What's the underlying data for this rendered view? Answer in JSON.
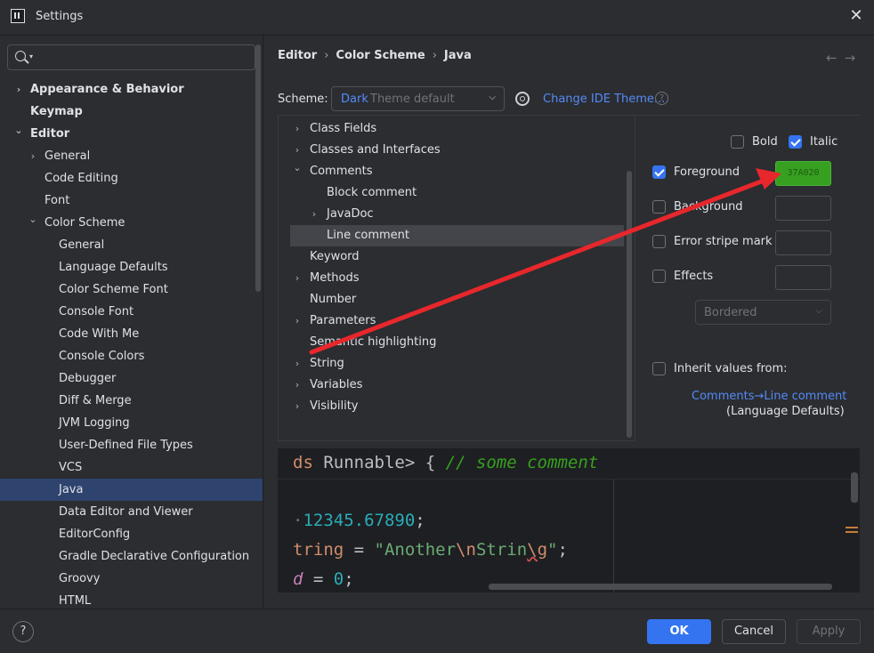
{
  "window": {
    "title": "Settings"
  },
  "search": {
    "placeholder": "",
    "value": ""
  },
  "sidebar": {
    "items": [
      {
        "label": "Appearance & Behavior",
        "level": 0,
        "chevron": ">",
        "bold": true
      },
      {
        "label": "Keymap",
        "level": 0,
        "chevron": "",
        "bold": true
      },
      {
        "label": "Editor",
        "level": 0,
        "chevron": "v",
        "bold": true
      },
      {
        "label": "General",
        "level": 1,
        "chevron": ">"
      },
      {
        "label": "Code Editing",
        "level": 1,
        "chevron": ""
      },
      {
        "label": "Font",
        "level": 1,
        "chevron": ""
      },
      {
        "label": "Color Scheme",
        "level": 1,
        "chevron": "v"
      },
      {
        "label": "General",
        "level": 2,
        "chevron": ""
      },
      {
        "label": "Language Defaults",
        "level": 2,
        "chevron": ""
      },
      {
        "label": "Color Scheme Font",
        "level": 2,
        "chevron": ""
      },
      {
        "label": "Console Font",
        "level": 2,
        "chevron": ""
      },
      {
        "label": "Code With Me",
        "level": 2,
        "chevron": ""
      },
      {
        "label": "Console Colors",
        "level": 2,
        "chevron": ""
      },
      {
        "label": "Debugger",
        "level": 2,
        "chevron": ""
      },
      {
        "label": "Diff & Merge",
        "level": 2,
        "chevron": ""
      },
      {
        "label": "JVM Logging",
        "level": 2,
        "chevron": ""
      },
      {
        "label": "User-Defined File Types",
        "level": 2,
        "chevron": ""
      },
      {
        "label": "VCS",
        "level": 2,
        "chevron": ""
      },
      {
        "label": "Java",
        "level": 2,
        "chevron": "",
        "selected": true
      },
      {
        "label": "Data Editor and Viewer",
        "level": 2,
        "chevron": ""
      },
      {
        "label": "EditorConfig",
        "level": 2,
        "chevron": ""
      },
      {
        "label": "Gradle Declarative Configuration",
        "level": 2,
        "chevron": ""
      },
      {
        "label": "Groovy",
        "level": 2,
        "chevron": ""
      },
      {
        "label": "HTML",
        "level": 2,
        "chevron": ""
      }
    ]
  },
  "breadcrumb": {
    "items": [
      "Editor",
      "Color Scheme",
      "Java"
    ]
  },
  "scheme": {
    "label": "Scheme:",
    "value_name": "Dark",
    "value_suffix": "Theme default",
    "change_theme": "Change IDE Theme..."
  },
  "attributes": {
    "items": [
      {
        "label": "Class Fields",
        "level": 0,
        "chevron": ">"
      },
      {
        "label": "Classes and Interfaces",
        "level": 0,
        "chevron": ">"
      },
      {
        "label": "Comments",
        "level": 0,
        "chevron": "v"
      },
      {
        "label": "Block comment",
        "level": 1,
        "chevron": ""
      },
      {
        "label": "JavaDoc",
        "level": 1,
        "chevron": ">"
      },
      {
        "label": "Line comment",
        "level": 1,
        "chevron": "",
        "selected": true
      },
      {
        "label": "Keyword",
        "level": 0,
        "chevron": ""
      },
      {
        "label": "Methods",
        "level": 0,
        "chevron": ">"
      },
      {
        "label": "Number",
        "level": 0,
        "chevron": ""
      },
      {
        "label": "Parameters",
        "level": 0,
        "chevron": ">"
      },
      {
        "label": "Semantic highlighting",
        "level": 0,
        "chevron": ""
      },
      {
        "label": "String",
        "level": 0,
        "chevron": ">"
      },
      {
        "label": "Variables",
        "level": 0,
        "chevron": ">"
      },
      {
        "label": "Visibility",
        "level": 0,
        "chevron": ">"
      }
    ]
  },
  "options": {
    "bold": {
      "label": "Bold",
      "checked": false
    },
    "italic": {
      "label": "Italic",
      "checked": true
    },
    "foreground": {
      "label": "Foreground",
      "checked": true,
      "color_text": "37A020",
      "color": "#37a020"
    },
    "background": {
      "label": "Background",
      "checked": false
    },
    "error_stripe": {
      "label": "Error stripe mark",
      "checked": false
    },
    "effects": {
      "label": "Effects",
      "checked": false,
      "effect_type": "Bordered"
    },
    "inherit": {
      "label": "Inherit values from:",
      "checked": false,
      "link": "Comments→Line comment",
      "sub": "(Language Defaults)"
    }
  },
  "preview": {
    "line1": {
      "kw": "ds",
      "tx": " Runnable> { ",
      "cm": "// some comment"
    },
    "line2": {
      "tx": "·",
      "num": "12345.67890",
      "end": ";"
    },
    "line3": {
      "kw": "tring",
      "tx": " = ",
      "q1": "\"Another",
      "esc1": "\\n",
      "mid": "Strin",
      "esc2": "\\g",
      "q2": "\"",
      "end": ";"
    },
    "line4": {
      "var": "d",
      "tx": " = ",
      "num": "0",
      "end": ";"
    }
  },
  "buttons": {
    "ok": "OK",
    "cancel": "Cancel",
    "apply": "Apply",
    "help": "?"
  },
  "colors": {
    "accent": "#3574f0",
    "link": "#548af7",
    "comment_green": "#37a020",
    "annotation_red": "#e8272c"
  }
}
